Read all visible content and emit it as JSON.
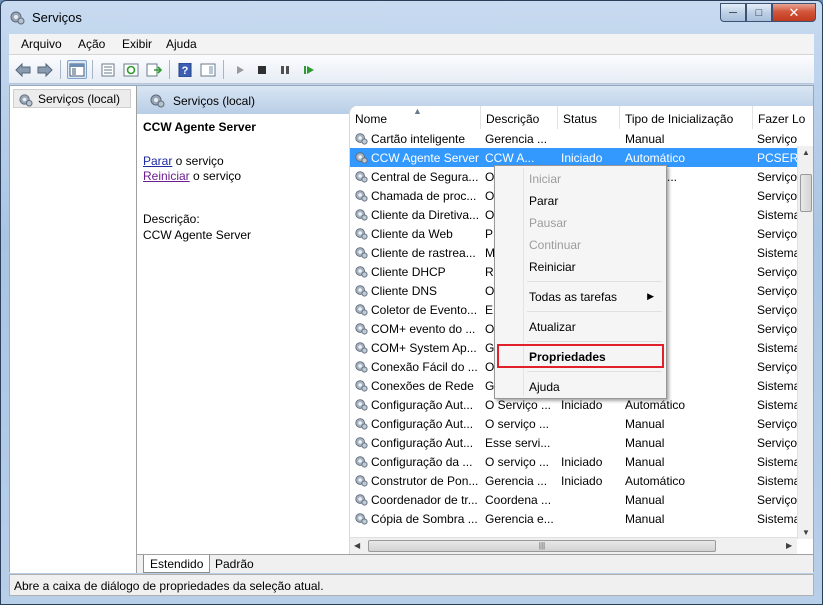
{
  "window": {
    "title": "Serviços"
  },
  "menu": [
    "Arquivo",
    "Ação",
    "Exibir",
    "Ajuda"
  ],
  "tree": {
    "item": "Serviços (local)"
  },
  "header": {
    "title": "Serviços (local)"
  },
  "extended": {
    "service_name": "CCW Agente Server",
    "stop_link": "Parar",
    "stop_suffix": " o serviço",
    "restart_link": "Reiniciar",
    "restart_suffix": " o serviço",
    "desc_label": "Descrição:",
    "desc_value": "CCW Agente Server"
  },
  "columns": [
    "Nome",
    "Descrição",
    "Status",
    "Tipo de Inicialização",
    "Fazer Lo"
  ],
  "rows": [
    {
      "name": "Cartão inteligente",
      "desc": "Gerencia ...",
      "status": "",
      "startup": "Manual",
      "logon": "Serviço"
    },
    {
      "name": "CCW Agente Server",
      "desc": "CCW A...",
      "status": "Iniciado",
      "startup": "Automático",
      "logon": "PCSERV"
    },
    {
      "name": "Central de Segura...",
      "desc": "O",
      "status": "",
      "startup": "(Atraso ...",
      "logon": "Serviço"
    },
    {
      "name": "Chamada de proc...",
      "desc": "O",
      "status": "",
      "startup": "",
      "logon": "Serviço"
    },
    {
      "name": "Cliente da Diretiva...",
      "desc": "O",
      "status": "",
      "startup": "",
      "logon": "Sistema"
    },
    {
      "name": "Cliente da Web",
      "desc": "P",
      "status": "",
      "startup": "",
      "logon": "Serviço"
    },
    {
      "name": "Cliente de rastrea...",
      "desc": "M",
      "status": "",
      "startup": "",
      "logon": "Sistema"
    },
    {
      "name": "Cliente DHCP",
      "desc": "R",
      "status": "",
      "startup": "",
      "logon": "Serviço"
    },
    {
      "name": "Cliente DNS",
      "desc": "O",
      "status": "",
      "startup": "",
      "logon": "Serviço"
    },
    {
      "name": "Coletor de Evento...",
      "desc": "E",
      "status": "",
      "startup": "",
      "logon": "Serviço"
    },
    {
      "name": "COM+ evento do ...",
      "desc": "O",
      "status": "",
      "startup": "",
      "logon": "Serviço"
    },
    {
      "name": "COM+ System Ap...",
      "desc": "G",
      "status": "",
      "startup": "",
      "logon": "Sistema"
    },
    {
      "name": "Conexão Fácil do ...",
      "desc": "O",
      "status": "",
      "startup": "",
      "logon": "Serviço"
    },
    {
      "name": "Conexões de Rede",
      "desc": "G",
      "status": "",
      "startup": "",
      "logon": "Sistema"
    },
    {
      "name": "Configuração Aut...",
      "desc": "O Serviço ...",
      "status": "Iniciado",
      "startup": "Automático",
      "logon": "Sistema"
    },
    {
      "name": "Configuração Aut...",
      "desc": "O serviço ...",
      "status": "",
      "startup": "Manual",
      "logon": "Serviço"
    },
    {
      "name": "Configuração Aut...",
      "desc": "Esse servi...",
      "status": "",
      "startup": "Manual",
      "logon": "Serviço"
    },
    {
      "name": "Configuração da ...",
      "desc": "O serviço ...",
      "status": "Iniciado",
      "startup": "Manual",
      "logon": "Sistema"
    },
    {
      "name": "Construtor de Pon...",
      "desc": "Gerencia ...",
      "status": "Iniciado",
      "startup": "Automático",
      "logon": "Sistema"
    },
    {
      "name": "Coordenador de tr...",
      "desc": "Coordena ...",
      "status": "",
      "startup": "Manual",
      "logon": "Serviço"
    },
    {
      "name": "Cópia de Sombra ...",
      "desc": "Gerencia e...",
      "status": "",
      "startup": "Manual",
      "logon": "Sistema"
    }
  ],
  "context_menu": [
    {
      "label": "Iniciar",
      "disabled": true
    },
    {
      "label": "Parar",
      "disabled": false
    },
    {
      "label": "Pausar",
      "disabled": true
    },
    {
      "label": "Continuar",
      "disabled": true
    },
    {
      "label": "Reiniciar",
      "disabled": false
    },
    {
      "label": "Todas as tarefas",
      "disabled": false
    },
    {
      "label": "Atualizar",
      "disabled": false
    },
    {
      "label": "Propriedades",
      "disabled": false
    },
    {
      "label": "Ajuda",
      "disabled": false
    }
  ],
  "tabs": [
    "Estendido",
    "Padrão"
  ],
  "status_bar": "Abre a caixa de diálogo de propriedades da seleção atual.",
  "scroll": {
    "h_grip": "|||"
  },
  "colors": {
    "selection": "#3399ff",
    "highlight_box": "#e0202a",
    "link": "#1c2aa5"
  }
}
